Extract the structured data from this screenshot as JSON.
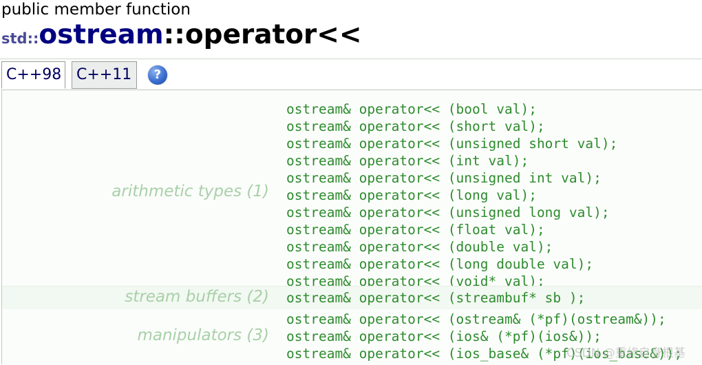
{
  "page": {
    "kind": "public member function",
    "title": {
      "ns": "std::",
      "cls": "ostream",
      "sep": "::",
      "fn": "operator<<"
    }
  },
  "tabs": [
    {
      "label": "C++98"
    },
    {
      "label": "C++11"
    }
  ],
  "help": {
    "glyph": "?"
  },
  "groups": [
    {
      "label": "arithmetic types (1)",
      "lines": [
        "ostream& operator<< (bool val);",
        "ostream& operator<< (short val);",
        "ostream& operator<< (unsigned short val);",
        "ostream& operator<< (int val);",
        "ostream& operator<< (unsigned int val);",
        "ostream& operator<< (long val);",
        "ostream& operator<< (unsigned long val);",
        "ostream& operator<< (float val);",
        "ostream& operator<< (double val);",
        "ostream& operator<< (long double val);",
        "ostream& operator<< (void* val);"
      ]
    },
    {
      "label": "stream buffers (2)",
      "lines": [
        "ostream& operator<< (streambuf* sb );"
      ]
    },
    {
      "label": "manipulators (3)",
      "lines": [
        "ostream& operator<< (ostream& (*pf)(ostream&));",
        "ostream& operator<< (ios& (*pf)(ios&));",
        "ostream& operator<< (ios_base& (*pf)(ios_base&));"
      ]
    }
  ],
  "watermark": "CSDN @重修自身根基",
  "colors": {
    "code": "#2e8b2e",
    "label": "#a8d0a8",
    "class_name": "#000080"
  }
}
